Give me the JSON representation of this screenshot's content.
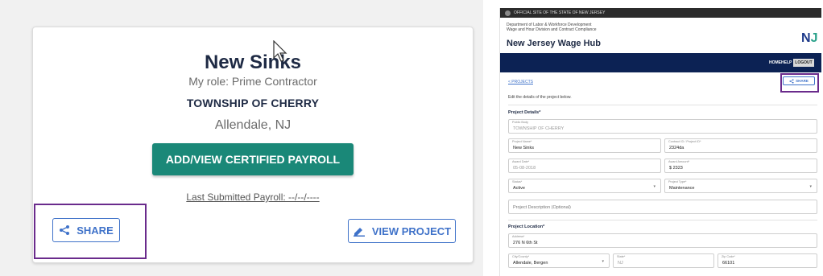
{
  "left_card": {
    "title": "New Sinks",
    "role": "My role: Prime Contractor",
    "organization": "TOWNSHIP OF CHERRY",
    "location": "Allendale, NJ",
    "payroll_button": "ADD/VIEW CERTIFIED PAYROLL",
    "last_submitted": "Last Submitted Payroll: --/--/----",
    "share_button": "SHARE",
    "view_project_button": "VIEW PROJECT"
  },
  "right_page": {
    "official_banner": "OFFICIAL SITE OF THE STATE OF NEW JERSEY",
    "dept_lines": [
      "Department of Labor & Workforce Development",
      "Wage and Hour Division and Contract Compliance"
    ],
    "site_title": "New Jersey Wage Hub",
    "logo_text": "NJ",
    "nav": {
      "home": "HOME",
      "help": "HELP",
      "logout": "LOGOUT"
    },
    "back_link": "< PROJECTS",
    "share_button": "SHARE",
    "edit_text": "Edit the details of the project below.",
    "project_details_heading": "Project Details*",
    "fields": {
      "public_body": {
        "label": "Public Body",
        "value": "TOWNSHIP OF CHERRY"
      },
      "project_name": {
        "label": "Project Name*",
        "value": "New Sinks"
      },
      "contract_id": {
        "label": "Contract ID / Project ID*",
        "value": "2324da"
      },
      "award_date": {
        "label": "Award Date*",
        "value": "05-08-2018"
      },
      "award_amount": {
        "label": "Award Amount*",
        "value": "$ 2323"
      },
      "status": {
        "label": "Status*",
        "value": "Active"
      },
      "project_type": {
        "label": "Project Type*",
        "value": "Maintenance"
      },
      "description": {
        "placeholder": "Project Description (Optional)"
      }
    },
    "location_heading": "Project Location*",
    "location_fields": {
      "address": {
        "label": "Address*",
        "value": "276 N 6th St"
      },
      "city_county": {
        "label": "City/County*",
        "value": "Allendale, Bergen"
      },
      "state": {
        "label": "State*",
        "value": "NJ"
      },
      "zip": {
        "label": "Zip Code*",
        "value": "66101"
      }
    }
  },
  "colors": {
    "teal_button": "#1a8878",
    "link_blue": "#3f72c9",
    "highlight_purple": "#6a2b8c",
    "navy": "#0c2254"
  }
}
